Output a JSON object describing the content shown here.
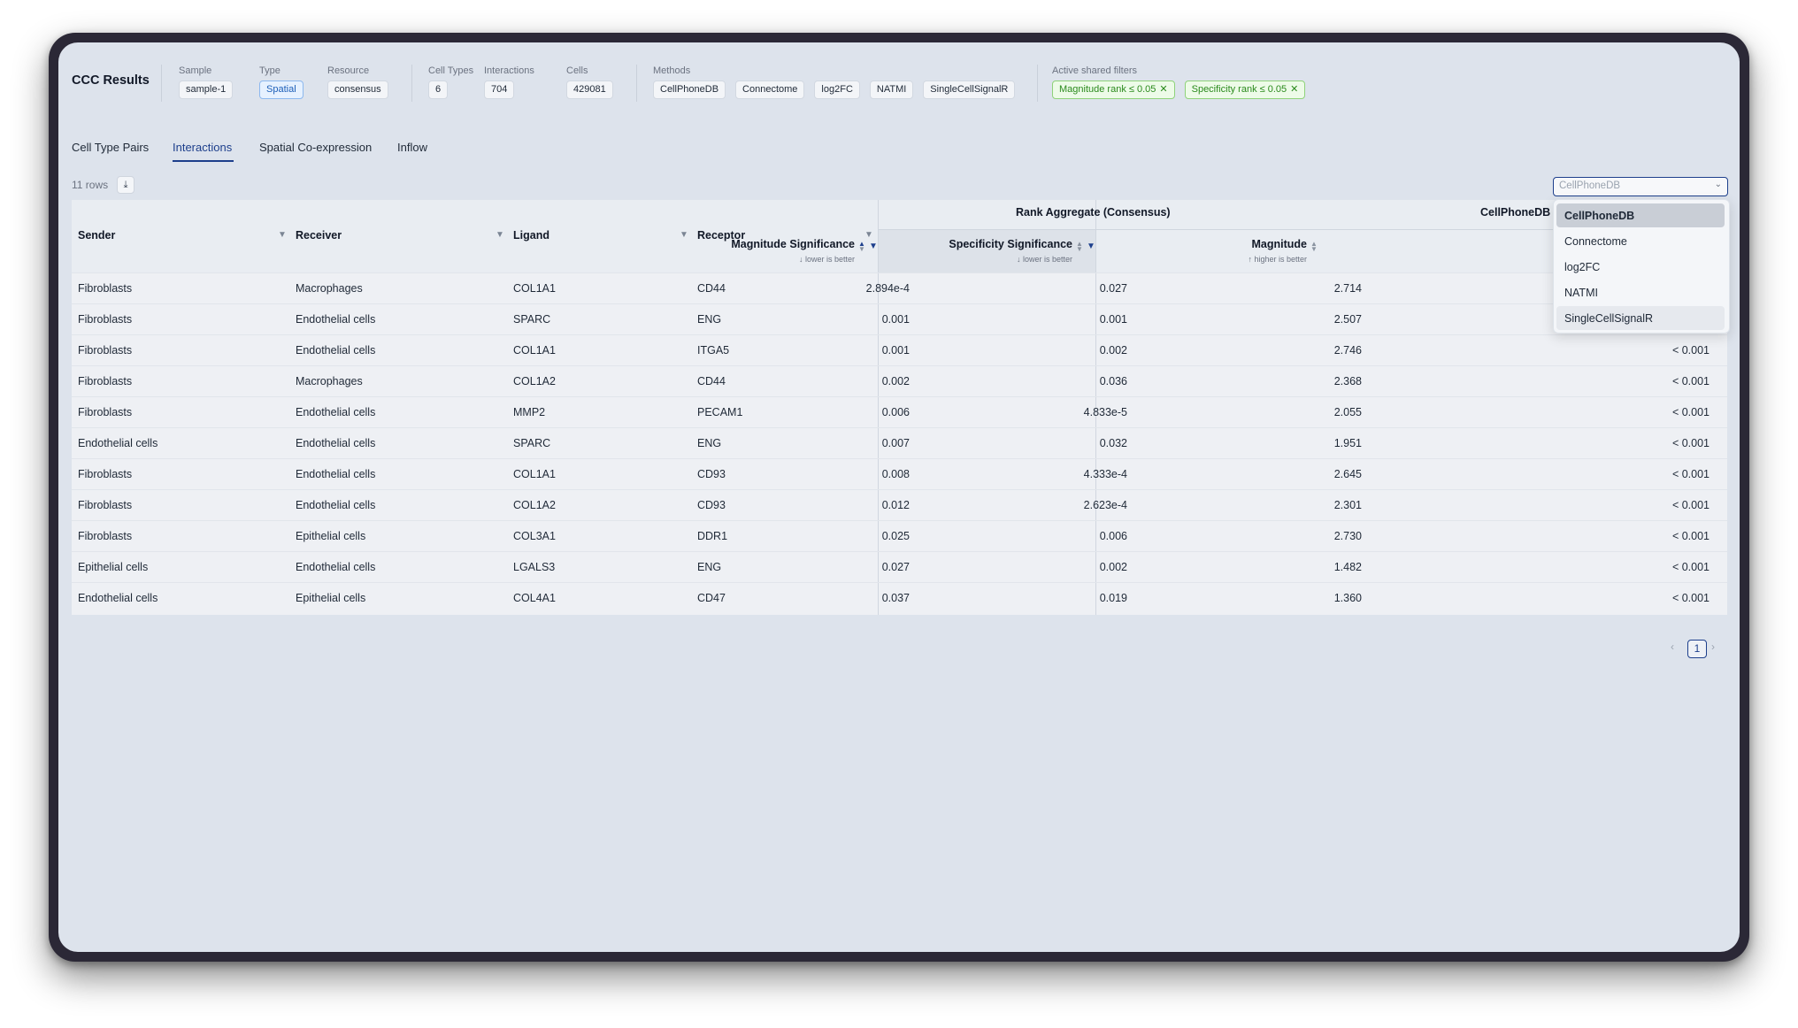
{
  "app": {
    "title": "CCC Results"
  },
  "header": {
    "sample": {
      "label": "Sample",
      "value": "sample-1"
    },
    "type": {
      "label": "Type",
      "value": "Spatial"
    },
    "resource": {
      "label": "Resource",
      "value": "consensus"
    },
    "cell_types": {
      "label": "Cell Types",
      "value": "6"
    },
    "interactions": {
      "label": "Interactions",
      "value": "704"
    },
    "cells": {
      "label": "Cells",
      "value": "429081"
    },
    "methods": {
      "label": "Methods",
      "items": [
        "CellPhoneDB",
        "Connectome",
        "log2FC",
        "NATMI",
        "SingleCellSignalR"
      ]
    },
    "filters": {
      "label": "Active shared filters",
      "items": [
        "Magnitude rank ≤ 0.05",
        "Specificity rank ≤ 0.05"
      ]
    }
  },
  "tabs": [
    "Cell Type Pairs",
    "Interactions",
    "Spatial Co-expression",
    "Inflow"
  ],
  "active_tab": "Interactions",
  "toolbar": {
    "row_count": "11 rows",
    "download_icon": "download-icon"
  },
  "table": {
    "columns": {
      "sender": "Sender",
      "receiver": "Receiver",
      "ligand": "Ligand",
      "receptor": "Receptor"
    },
    "groups": {
      "rank": "Rank Aggregate (Consensus)",
      "method": "CellPhoneDB"
    },
    "metric_columns": {
      "mag_sig": {
        "label": "Magnitude Significance",
        "sub": "↓ lower is better"
      },
      "spec_sig": {
        "label": "Specificity Significance",
        "sub": "↓ lower is better"
      },
      "magnitude": {
        "label": "Magnitude",
        "sub": "↑ higher is better"
      }
    },
    "rows": [
      [
        "Fibroblasts",
        "Macrophages",
        "COL1A1",
        "CD44",
        "2.894e-4",
        "0.027",
        "2.714",
        ""
      ],
      [
        "Fibroblasts",
        "Endothelial cells",
        "SPARC",
        "ENG",
        "0.001",
        "0.001",
        "2.507",
        ""
      ],
      [
        "Fibroblasts",
        "Endothelial cells",
        "COL1A1",
        "ITGA5",
        "0.001",
        "0.002",
        "2.746",
        "< 0.001"
      ],
      [
        "Fibroblasts",
        "Macrophages",
        "COL1A2",
        "CD44",
        "0.002",
        "0.036",
        "2.368",
        "< 0.001"
      ],
      [
        "Fibroblasts",
        "Endothelial cells",
        "MMP2",
        "PECAM1",
        "0.006",
        "4.833e-5",
        "2.055",
        "< 0.001"
      ],
      [
        "Endothelial cells",
        "Endothelial cells",
        "SPARC",
        "ENG",
        "0.007",
        "0.032",
        "1.951",
        "< 0.001"
      ],
      [
        "Fibroblasts",
        "Endothelial cells",
        "COL1A1",
        "CD93",
        "0.008",
        "4.333e-4",
        "2.645",
        "< 0.001"
      ],
      [
        "Fibroblasts",
        "Endothelial cells",
        "COL1A2",
        "CD93",
        "0.012",
        "2.623e-4",
        "2.301",
        "< 0.001"
      ],
      [
        "Fibroblasts",
        "Epithelial cells",
        "COL3A1",
        "DDR1",
        "0.025",
        "0.006",
        "2.730",
        "< 0.001"
      ],
      [
        "Epithelial cells",
        "Endothelial cells",
        "LGALS3",
        "ENG",
        "0.027",
        "0.002",
        "1.482",
        "< 0.001"
      ],
      [
        "Endothelial cells",
        "Epithelial cells",
        "COL4A1",
        "CD47",
        "0.037",
        "0.019",
        "1.360",
        "< 0.001"
      ]
    ]
  },
  "method_select": {
    "placeholder": "CellPhoneDB",
    "options": [
      "CellPhoneDB",
      "Connectome",
      "log2FC",
      "NATMI",
      "SingleCellSignalR"
    ],
    "selected": "CellPhoneDB",
    "hovered": "SingleCellSignalR"
  },
  "pagination": {
    "prev": "‹",
    "current": "1",
    "next": "›"
  },
  "colors": {
    "accent": "#1d3f8c",
    "type_chip": "#1d5fb8",
    "filter_chip": "#2a8a1c"
  }
}
